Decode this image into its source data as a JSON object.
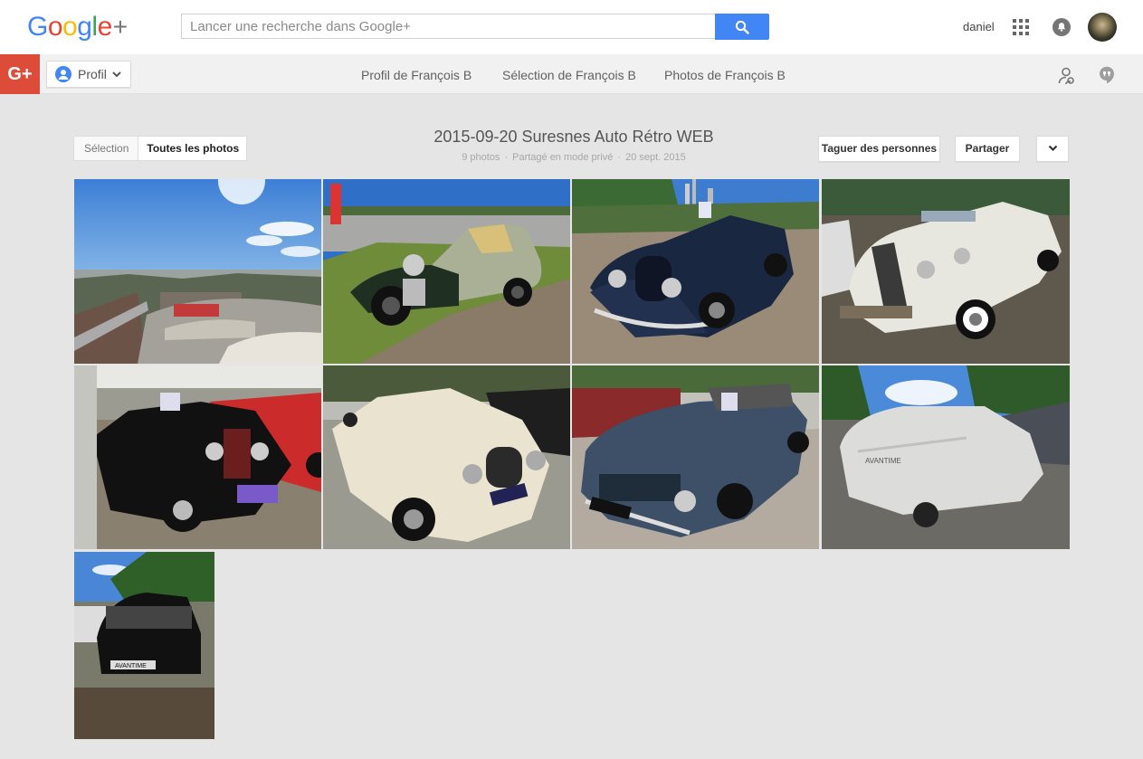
{
  "header": {
    "logo_text": "Google+",
    "search_placeholder": "Lancer une recherche dans Google+",
    "username": "daniel",
    "icons": [
      "search-icon",
      "apps-grid-icon",
      "notifications-bell-icon",
      "avatar"
    ]
  },
  "subnav": {
    "gplus_label": "G+",
    "profile_label": "Profil",
    "links": [
      "Profil de François B",
      "Sélection de François B",
      "Photos de François B"
    ],
    "icons": [
      "collaborators-icon",
      "hangouts-icon"
    ]
  },
  "album": {
    "toggle": {
      "selection": "Sélection",
      "all_photos": "Toutes les photos",
      "active": "all_photos"
    },
    "title": "2015-09-20 Suresnes Auto Rétro WEB",
    "meta": {
      "count": "9 photos",
      "visibility": "Partagé en mode privé",
      "date": "20 sept. 2015"
    },
    "actions": {
      "tag": "Taguer des personnes",
      "share": "Partager"
    }
  },
  "photos": [
    {
      "id": 1,
      "subject": "sky-panorama"
    },
    {
      "id": 2,
      "subject": "green-vintage-car"
    },
    {
      "id": 3,
      "subject": "blue-roadster"
    },
    {
      "id": 4,
      "subject": "white-convertible"
    },
    {
      "id": 5,
      "subject": "black-mg-red-cars"
    },
    {
      "id": 6,
      "subject": "cream-morgan"
    },
    {
      "id": 7,
      "subject": "grey-mercedes"
    },
    {
      "id": 8,
      "subject": "covered-car",
      "label": "AVANTIME"
    },
    {
      "id": 9,
      "subject": "renault-avantime",
      "label": "AVANTIME"
    }
  ],
  "colors": {
    "google_blue": "#4285f4",
    "gplus_red": "#dd4b39",
    "page_bg": "#e5e5e5"
  }
}
